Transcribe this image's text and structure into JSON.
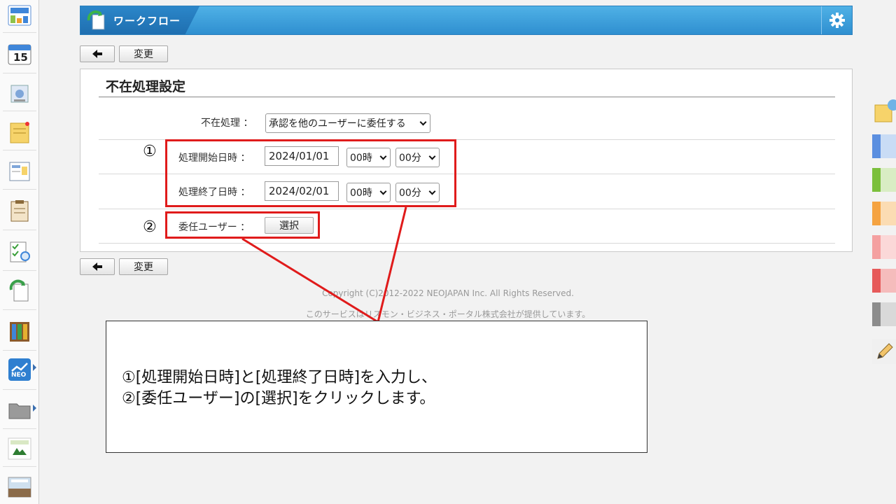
{
  "header": {
    "title": "ワークフロー"
  },
  "toolbar": {
    "back_label": "◀",
    "change_label": "変更"
  },
  "form": {
    "heading": "不在処理設定",
    "absence_label": "不在処理 ：",
    "absence_value": "承認を他のユーザーに委任する",
    "start_label": "処理開始日時 ：",
    "start_date": "2024/01/01",
    "start_hour": "00時",
    "start_minute": "00分",
    "end_label": "処理終了日時 ：",
    "end_date": "2024/02/01",
    "end_hour": "00時",
    "end_minute": "00分",
    "delegate_label": "委任ユーザー ：",
    "select_button": "選択"
  },
  "markers": {
    "one": "①",
    "two": "②"
  },
  "footer": {
    "copyright": "Copyright (C)2012-2022 NEOJAPAN Inc. All Rights Reserved.",
    "provider": "このサービスはリスモン・ビジネス・ポータル株式会社が提供しています。"
  },
  "callout": {
    "line1": "①[処理開始日時]と[処理終了日時]を入力し、",
    "line2": "②[委任ユーザー]の[選択]をクリックします。"
  },
  "sidebar_icons": [
    "portal-icon",
    "calendar-icon",
    "facility-icon",
    "memo-icon",
    "board-icon",
    "report-icon",
    "todo-icon",
    "workflow-icon",
    "cabinet-icon",
    "neo-icon",
    "folder-icon",
    "tanomeru-icon",
    "photo-icon"
  ],
  "calendar_day": "15",
  "neo_label": "NEO",
  "colors": {
    "header": "#3a9fdc",
    "accent_red": "#e01b1b"
  },
  "palette": [
    "#5b8fe0",
    "#7bbf3c",
    "#f5a341",
    "#f4a0a0",
    "#e65a5a",
    "#8c8c8c"
  ]
}
